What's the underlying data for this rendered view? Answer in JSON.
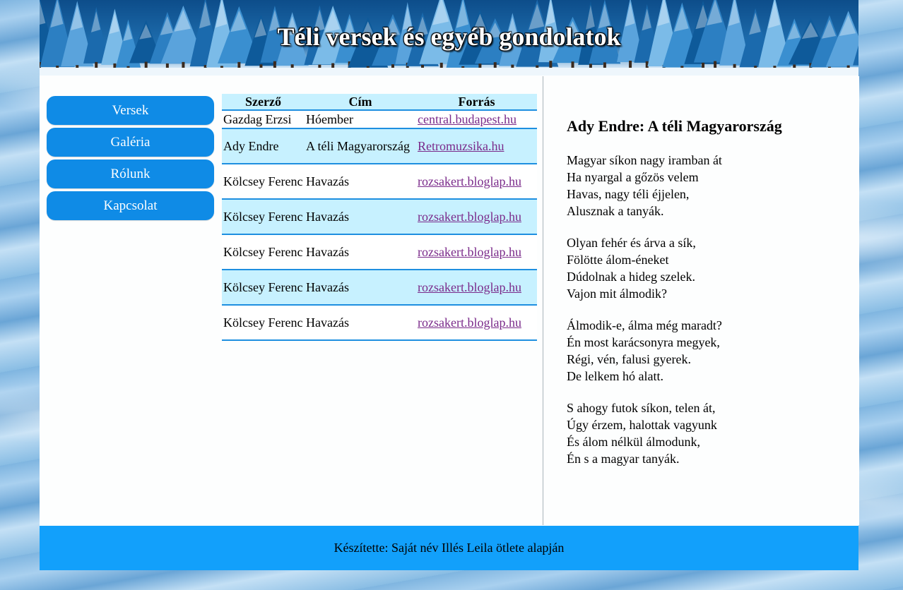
{
  "header": {
    "title": "Téli versek és egyéb gondolatok"
  },
  "nav": {
    "items": [
      {
        "label": "Versek"
      },
      {
        "label": "Galéria"
      },
      {
        "label": "Rólunk"
      },
      {
        "label": "Kapcsolat"
      }
    ]
  },
  "table": {
    "headers": [
      "Szerző",
      "Cím",
      "Forrás"
    ],
    "rows": [
      {
        "author": "Gazdag Erzsi",
        "title": "Hóember",
        "source": "central.budapest.hu"
      },
      {
        "author": "Ady Endre",
        "title": "A téli Magyarország",
        "source": "Retromuzsika.hu"
      },
      {
        "author": "Kölcsey Ferenc",
        "title": "Havazás",
        "source": "rozsakert.bloglap.hu"
      },
      {
        "author": "Kölcsey Ferenc",
        "title": "Havazás",
        "source": "rozsakert.bloglap.hu"
      },
      {
        "author": "Kölcsey Ferenc",
        "title": "Havazás",
        "source": "rozsakert.bloglap.hu"
      },
      {
        "author": "Kölcsey Ferenc",
        "title": "Havazás",
        "source": "rozsakert.bloglap.hu"
      },
      {
        "author": "Kölcsey Ferenc",
        "title": "Havazás",
        "source": "rozsakert.bloglap.hu"
      }
    ]
  },
  "poem": {
    "heading": "Ady Endre: A téli Magyarország",
    "stanzas": [
      [
        "Magyar síkon nagy iramban át",
        "Ha nyargal a gőzös velem",
        "Havas, nagy téli éjjelen,",
        "Alusznak a tanyák."
      ],
      [
        "Olyan fehér és árva a sík,",
        "Fölötte álom-éneket",
        "Dúdolnak a hideg szelek.",
        "Vajon mit álmodik?"
      ],
      [
        "Álmodik-e, álma még maradt?",
        "Én most karácsonyra megyek,",
        "Régi, vén, falusi gyerek.",
        "De lelkem hó alatt."
      ],
      [
        "S ahogy futok síkon, telen át,",
        "Úgy érzem, halottak vagyunk",
        "És álom nélkül álmodunk,",
        "Én s a magyar tanyák."
      ]
    ]
  },
  "footer": {
    "text": "Készítette: Saját név Illés Leila ötlete alapján"
  },
  "colors": {
    "nav": "#0f8be6",
    "footer": "#12a0fb",
    "table_stripe": "#c7f1ff",
    "table_border": "#1e8fe0",
    "link": "#7a2a8a"
  }
}
